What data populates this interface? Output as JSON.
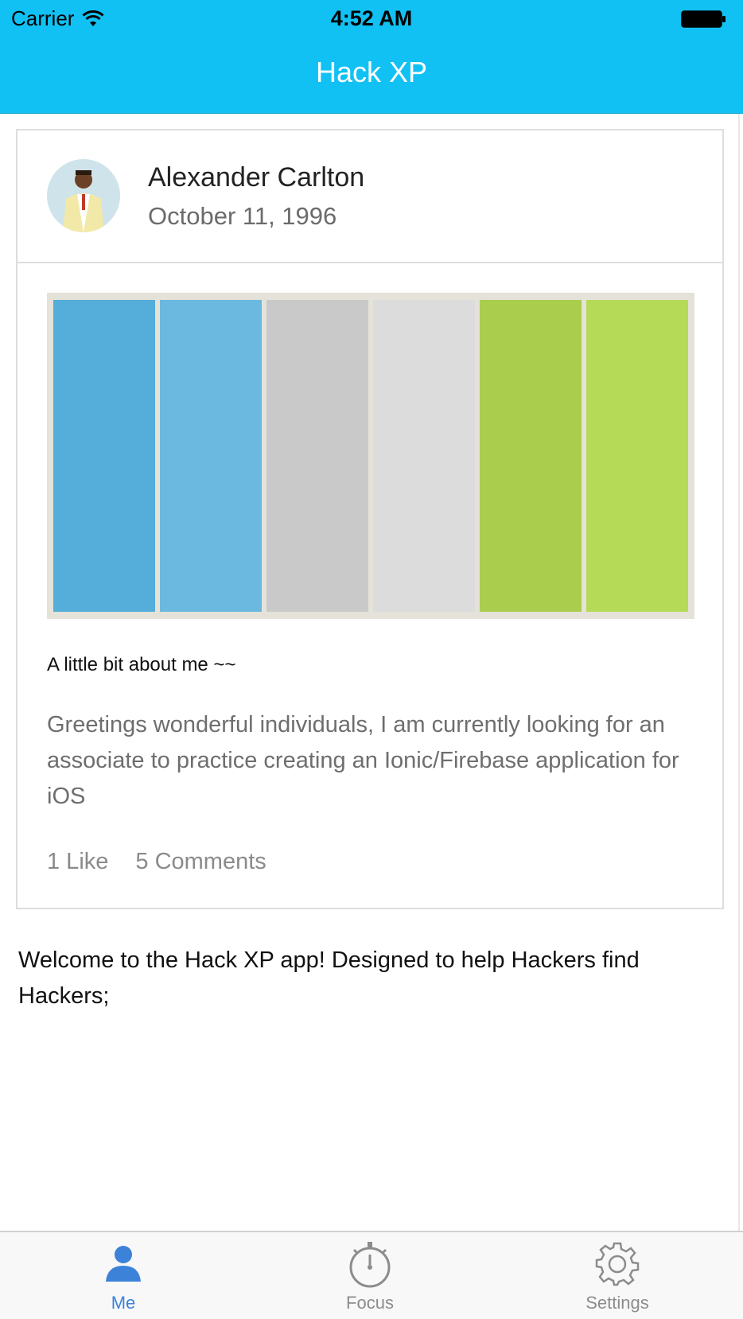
{
  "status_bar": {
    "carrier": "Carrier",
    "time": "4:52 AM"
  },
  "nav": {
    "title": "Hack XP"
  },
  "card": {
    "author": "Alexander Carlton",
    "date": "October 11, 1996",
    "swatches": [
      "#55add9",
      "#6bb8e0",
      "#c9c9c9",
      "#dcdcdc",
      "#aacd4e",
      "#b5da58"
    ],
    "about_heading": "A little bit about me ~~",
    "body": "Greetings wonderful individuals, I am currently looking for an associate to practice creating an Ionic/Firebase application for iOS",
    "likes": "1 Like",
    "comments": "5 Comments"
  },
  "welcome": "Welcome to the Hack XP app! Designed to help Hackers find Hackers;",
  "tabs": [
    {
      "label": "Me",
      "icon": "person-icon",
      "active": true
    },
    {
      "label": "Focus",
      "icon": "stopwatch-icon",
      "active": false
    },
    {
      "label": "Settings",
      "icon": "gear-icon",
      "active": false
    }
  ],
  "colors": {
    "nav_bg": "#11c1f3",
    "active_tab": "#3b82d8",
    "inactive_tab": "#8c8c8c"
  }
}
